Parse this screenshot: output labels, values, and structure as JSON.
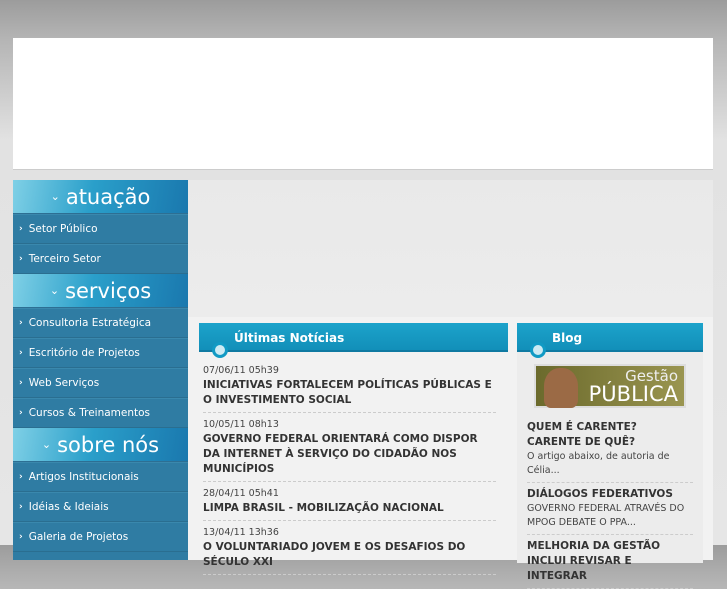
{
  "sidebar": {
    "sections": [
      {
        "title": "atuação",
        "items": [
          "Setor Público",
          "Terceiro Setor"
        ]
      },
      {
        "title": "serviços",
        "items": [
          "Consultoria Estratégica",
          "Escritório de Projetos",
          "Web Serviços",
          "Cursos & Treinamentos"
        ]
      },
      {
        "title": "sobre nós",
        "items": [
          "Artigos Institucionais",
          "Idéias & Ideiais",
          "Galeria de Projetos"
        ]
      }
    ]
  },
  "news": {
    "title": "Últimas Notícias",
    "items": [
      {
        "date": "07/06/11 05h39",
        "title": "INICIATIVAS FORTALECEM POLÍTICAS PÚBLICAS E O INVESTIMENTO SOCIAL"
      },
      {
        "date": "10/05/11 08h13",
        "title": "GOVERNO FEDERAL ORIENTARÁ COMO DISPOR DA INTERNET À SERVIÇO DO CIDADÃO NOS MUNICÍPIOS"
      },
      {
        "date": "28/04/11 05h41",
        "title": "LIMPA BRASIL - MOBILIZAÇÃO NACIONAL"
      },
      {
        "date": "13/04/11 13h36",
        "title": "O VOLUNTARIADO JOVEM E OS DESAFIOS DO SÉCULO XXI"
      }
    ]
  },
  "blog": {
    "title": "Blog",
    "logo_line1": "Gestão",
    "logo_line2": "PÚBLICA",
    "items": [
      {
        "title": "QUEM É CARENTE? CARENTE DE QUÊ?",
        "summary": "O artigo abaixo, de autoria de Célia..."
      },
      {
        "title": "DIÁLOGOS FEDERATIVOS",
        "summary": "GOVERNO FEDERAL ATRAVÉS DO MPOG DEBATE O PPA..."
      },
      {
        "title": "MELHORIA DA GESTÃO INCLUI REVISAR E INTEGRAR",
        "summary": ""
      }
    ]
  }
}
